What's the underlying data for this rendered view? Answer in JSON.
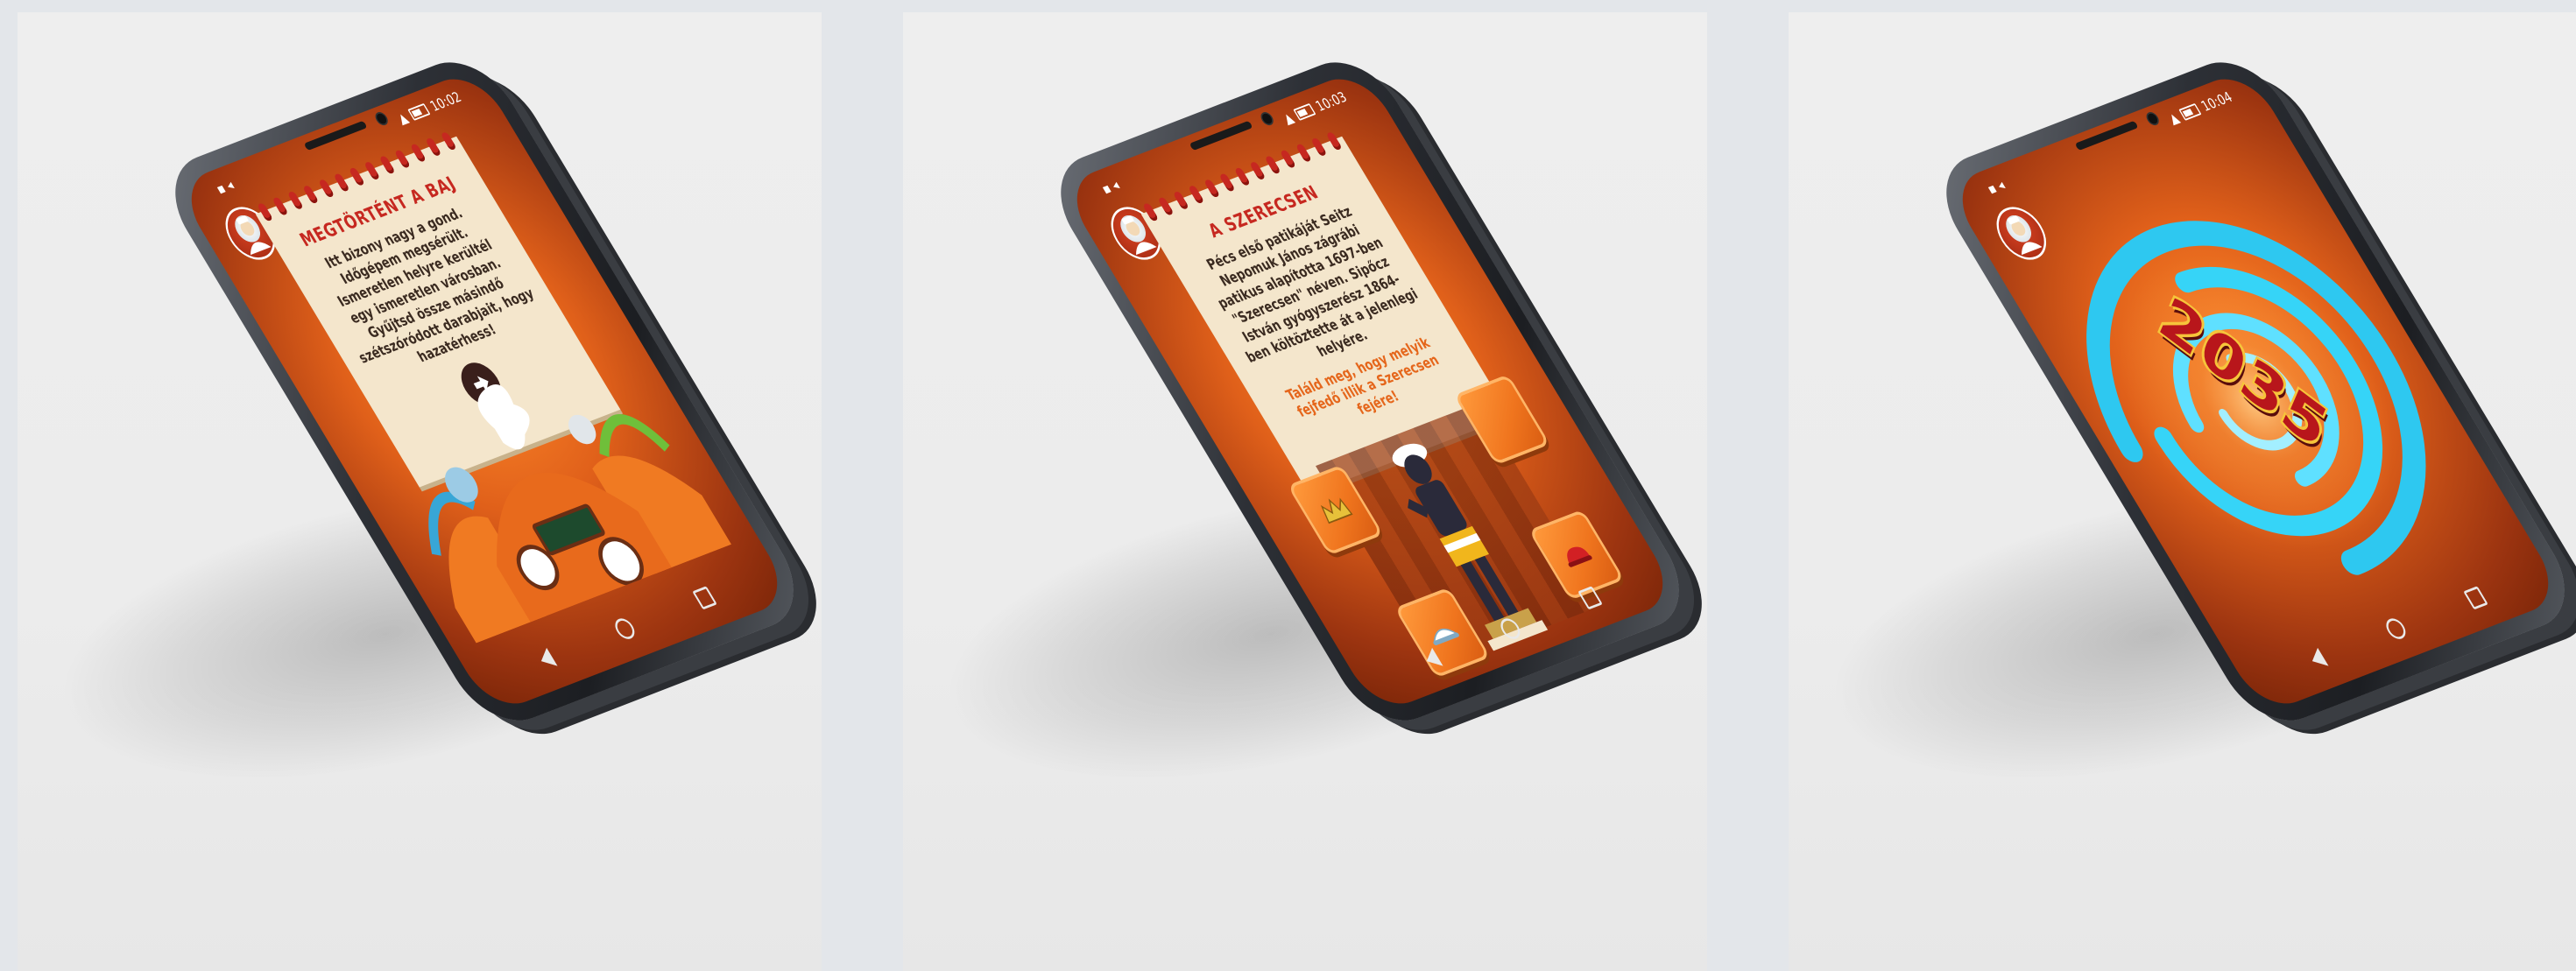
{
  "screens": [
    {
      "status_time": "10:02",
      "note_title": "MEGTÖRTÉNT A BAJ",
      "note_body": "Itt bizony nagy a gond. Időgépem megsérült. Ismeretlen helyre kerültél egy ismeretlen városban. Gyűjtsd össze másindő szétszóródott darabjait, hogy hazatérhess!",
      "next_button_icon": "arrow-right-icon"
    },
    {
      "status_time": "10:03",
      "note_title": "A SZERECSEN",
      "note_body": "Pécs első patikáját Seitz Nepomuk János zágrábi patikus alapította 1697-ben \"Szerecsen\" néven. Sipőcz István gyógyszerész 1864-ben költöztette át a jelenlegi helyére.",
      "note_highlight": "Találd meg, hogy melyik fejfedő illik a Szerecsen fejére!",
      "tiles": [
        "crown-icon",
        "empty",
        "hat-icon",
        "red-hat-icon"
      ]
    },
    {
      "status_time": "10:04",
      "year": "2035"
    }
  ],
  "colors": {
    "background": "#e3e6ea",
    "screen_orange": "#e0601a",
    "title_red": "#c62820",
    "highlight_orange": "#e5661b",
    "vortex_blue": "#2ec8f0"
  }
}
